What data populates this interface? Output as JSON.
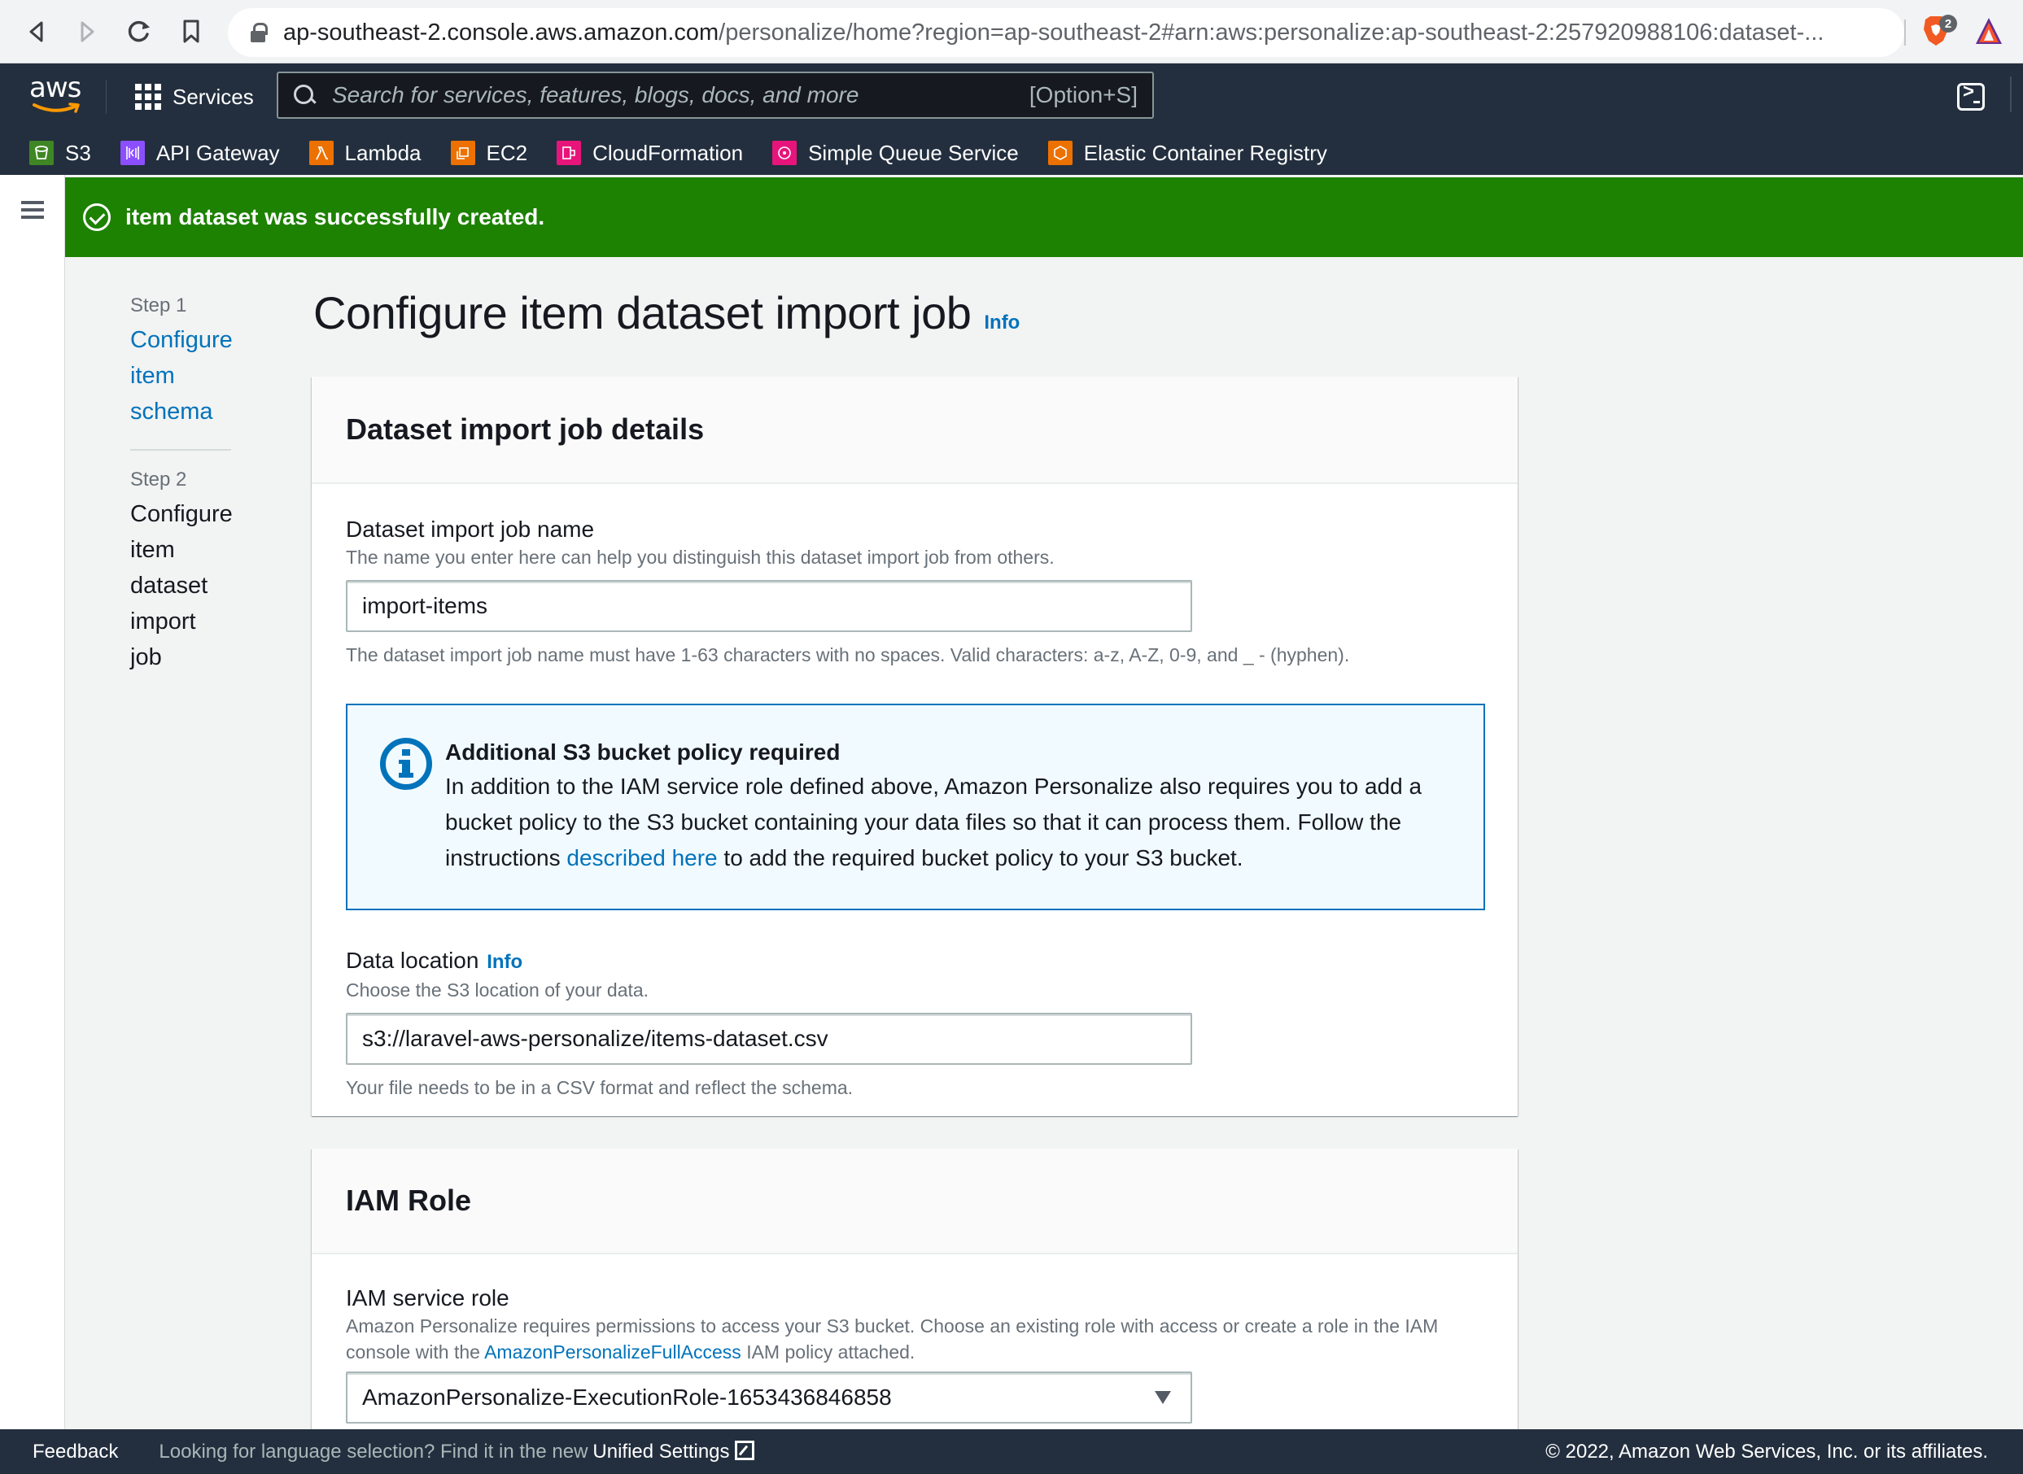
{
  "browser": {
    "url_host": "ap-southeast-2.console.aws.amazon.com",
    "url_rest": "/personalize/home?region=ap-southeast-2#arn:aws:personalize:ap-southeast-2:257920988106:dataset-...",
    "extension_badge": "2"
  },
  "topnav": {
    "logo": "aws",
    "services_label": "Services",
    "search_placeholder": "Search for services, features, blogs, docs, and more",
    "search_shortcut": "[Option+S]"
  },
  "favorites": [
    {
      "label": "S3",
      "icon": "s3-icon",
      "color": "#3f8624"
    },
    {
      "label": "API Gateway",
      "icon": "api-gateway-icon",
      "color": "#8c4fff"
    },
    {
      "label": "Lambda",
      "icon": "lambda-icon",
      "color": "#ed7100"
    },
    {
      "label": "EC2",
      "icon": "ec2-icon",
      "color": "#ed7100"
    },
    {
      "label": "CloudFormation",
      "icon": "cloudformation-icon",
      "color": "#e7157b"
    },
    {
      "label": "Simple Queue Service",
      "icon": "sqs-icon",
      "color": "#e7157b"
    },
    {
      "label": "Elastic Container Registry",
      "icon": "ecr-icon",
      "color": "#ed7100"
    }
  ],
  "flash": {
    "message": "item dataset was successfully created.",
    "color": "#1d8102"
  },
  "steps": [
    {
      "step": "Step 1",
      "title": "Configure item schema",
      "lines": [
        "Configure",
        "item",
        "schema"
      ],
      "state": "link"
    },
    {
      "step": "Step 2",
      "title": "Configure item dataset import job",
      "lines": [
        "Configure",
        "item",
        "dataset",
        "import",
        "job"
      ],
      "state": "current"
    }
  ],
  "page": {
    "title": "Configure item dataset import job",
    "info_label": "Info"
  },
  "details_card": {
    "title": "Dataset import job details",
    "job_name": {
      "label": "Dataset import job name",
      "description": "The name you enter here can help you distinguish this dataset import job from others.",
      "value": "import-items",
      "constraint": "The dataset import job name must have 1-63 characters with no spaces. Valid characters: a-z, A-Z, 0-9, and _ - (hyphen)."
    },
    "alert": {
      "title": "Additional S3 bucket policy required",
      "text_before": "In addition to the IAM service role defined above, Amazon Personalize also requires you to add a bucket policy to the S3 bucket containing your data files so that it can process them. Follow the instructions ",
      "link": "described here",
      "text_after": " to add the required bucket policy to your S3 bucket."
    },
    "data_location": {
      "label": "Data location",
      "info_label": "Info",
      "description": "Choose the S3 location of your data.",
      "value": "s3://laravel-aws-personalize/items-dataset.csv",
      "constraint": "Your file needs to be in a CSV format and reflect the schema."
    }
  },
  "iam_card": {
    "title": "IAM Role",
    "service_role": {
      "label": "IAM service role",
      "description_before": "Amazon Personalize requires permissions to access your S3 bucket. Choose an existing role with access or create a role in the IAM console with the ",
      "description_link": "AmazonPersonalizeFullAccess",
      "description_after": " IAM policy attached.",
      "selected": "AmazonPersonalize-ExecutionRole-1653436846858"
    }
  },
  "footer": {
    "feedback": "Feedback",
    "language_text": "Looking for language selection? Find it in the new",
    "unified_settings": "Unified Settings",
    "copyright": "© 2022, Amazon Web Services, Inc. or its affiliates."
  },
  "colors": {
    "link": "#0073bb",
    "nav_bg": "#232f3e",
    "page_bg": "#f2f3f3"
  }
}
